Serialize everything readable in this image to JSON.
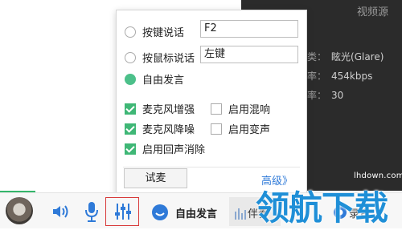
{
  "video_panel": {
    "title": "视频源",
    "rows": [
      {
        "key": "类：",
        "value": "眩光(Glare)"
      },
      {
        "key": "率：",
        "value": "454kbps"
      },
      {
        "key": "率：",
        "value": "30"
      }
    ],
    "site": "lhdown.com"
  },
  "popup": {
    "options": [
      {
        "label": "按键说话",
        "value": "F2",
        "selected": false
      },
      {
        "label": "按鼠标说话",
        "value": "左键",
        "selected": false
      },
      {
        "label": "自由发言",
        "selected": true
      }
    ],
    "checks": [
      {
        "label": "麦克风增强",
        "checked": true
      },
      {
        "label": "启用混响",
        "checked": false
      },
      {
        "label": "麦克风降噪",
        "checked": true
      },
      {
        "label": "启用变声",
        "checked": false
      },
      {
        "label": "启用回声消除",
        "checked": true
      }
    ],
    "test_button": "试麦",
    "advanced_link": "高级》"
  },
  "bottom_bar": {
    "free_speak": "自由发言",
    "seg_label": "伴奏",
    "record_label": "录音",
    "icons": [
      "avatar",
      "speaker-icon",
      "microphone-icon",
      "mixer-icon",
      "smile-icon",
      "equalizer-icon",
      "record-icon"
    ]
  },
  "watermark": "领航下载",
  "colors": {
    "accent_green": "#35b66b",
    "link_blue": "#2f7ad8",
    "highlight_red": "#d83a3a",
    "watermark_blue": "#1f8fd7"
  }
}
